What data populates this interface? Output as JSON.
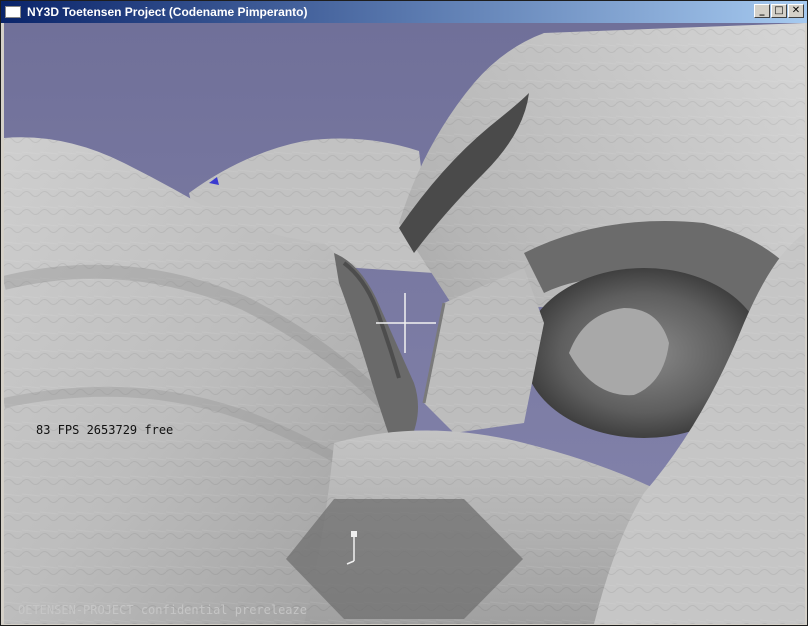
{
  "window": {
    "title": "NY3D Toetensen Project (Codename Pimperanto)",
    "minimize_label": "_",
    "maximize_label": "□",
    "close_label": "✕"
  },
  "hud": {
    "fps_text": "83 FPS 2653729 free",
    "footer_text": "OETENSEN-PROJECT confidential prereleaze"
  },
  "icons": [
    "app-icon",
    "crosshair-icon",
    "minimap-player-icon"
  ],
  "colors": {
    "sky": "#7b7ba3",
    "rock_light": "#d9d9d9",
    "rock_mid": "#a9a9a9",
    "rock_dark": "#5a5a5a",
    "minimap": "#6e6e6e"
  }
}
